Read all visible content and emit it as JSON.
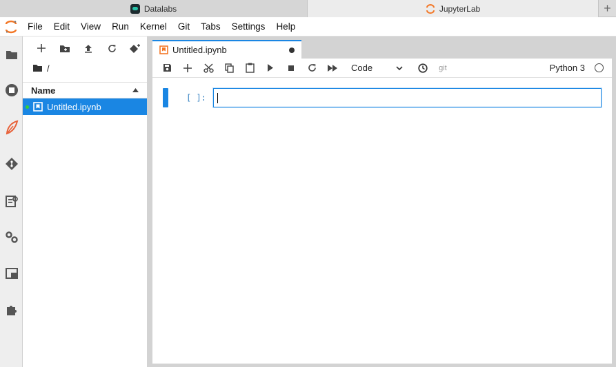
{
  "browser": {
    "tabs": [
      {
        "title": "Datalabs"
      },
      {
        "title": "JupyterLab"
      }
    ],
    "new_tab": "+"
  },
  "menu": [
    "File",
    "Edit",
    "View",
    "Run",
    "Kernel",
    "Git",
    "Tabs",
    "Settings",
    "Help"
  ],
  "activity_bar": [
    "folder-icon",
    "running-sessions-icon",
    "extension-leaf-icon",
    "git-icon",
    "property-inspector-icon",
    "settings-gears-icon",
    "tabs-panel-icon",
    "puzzle-icon"
  ],
  "file_browser": {
    "breadcrumb": "/",
    "header": "Name",
    "files": [
      {
        "name": "Untitled.ipynb",
        "selected": true,
        "running": true
      }
    ]
  },
  "notebook": {
    "tab_title": "Untitled.ipynb",
    "cell_type": "Code",
    "git_label": "git",
    "kernel": "Python 3",
    "cells": [
      {
        "prompt": "[ ]:",
        "source": ""
      }
    ]
  },
  "colors": {
    "accent": "#1a86e3",
    "jupyter_orange": "#f37726",
    "running_dot": "#35d035"
  }
}
